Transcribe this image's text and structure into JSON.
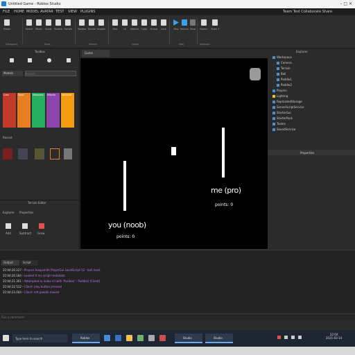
{
  "window": {
    "title": "Untitled Game - Roblox Studio",
    "controls": "–  □  ✕"
  },
  "menubar": {
    "items": [
      "FILE",
      "HOME",
      "MODEL",
      "AVATAR",
      "TEST",
      "VIEW",
      "PLUGINS"
    ],
    "right_text": "Team Test  Collaborate  Share"
  },
  "ribbon": {
    "buttons": [
      "Paste",
      "Select",
      "Move",
      "Scale",
      "Rotate",
      "Transform",
      "Toolbox",
      "Terrain",
      "Import",
      "Part",
      "UI",
      "Material",
      "Color",
      "Group",
      "Lock",
      "Anchor",
      "Play",
      "Resume",
      "Stop",
      "Game Settings",
      "Team Test",
      "Exit Game"
    ],
    "sections": [
      "Clipboard",
      "Tools",
      "Terrain",
      "Insert",
      "Edit",
      "Test",
      "Settings",
      "Team Test"
    ]
  },
  "left_panel": {
    "title": "Toolbox",
    "search_placeholder": "Search",
    "category": "Models",
    "swatches": [
      {
        "label": "Cars",
        "color": "#c0392b"
      },
      {
        "label": "Tools",
        "color": "#e67e22"
      },
      {
        "label": "Weapons",
        "color": "#27ae60"
      },
      {
        "label": "Effects",
        "color": "#8e44ad"
      },
      {
        "label": "Vehicles",
        "color": "#f39c12"
      }
    ],
    "section_two": "Recent",
    "bottom_tabs": [
      "Explorer",
      "Properties"
    ],
    "bottom_title": "Terrain Editor",
    "bottom_items": [
      "Add",
      "Subtract",
      "Grow"
    ]
  },
  "viewport": {
    "tab": "Game",
    "left_player": {
      "name": "you (noob)",
      "points": "points: 0"
    },
    "right_player": {
      "name": "me (pro)",
      "points": "points: 0"
    }
  },
  "right_panel": {
    "title": "Explorer",
    "tree": [
      "Workspace",
      "Camera",
      "Terrain",
      "Ball",
      "Paddle1",
      "Paddle2",
      "Players",
      "Lighting",
      "ReplicatedStorage",
      "ServerScriptService",
      "StarterGui",
      "StarterPack",
      "Teams",
      "SoundService"
    ],
    "properties_title": "Properties"
  },
  "output": {
    "tabs": [
      "Output",
      "Script"
    ],
    "lines": [
      {
        "time": "22:04:20.127",
        "msg": "Players.hoopsmith.PlayerGui.LocalScript:12 - ball reset"
      },
      {
        "time": "22:04:20.184",
        "msg": "Loaded 0 ms script metadata"
      },
      {
        "time": "22:04:21.301",
        "msg": "Attempted to index nil with 'Position' - Paddle1 [Client]"
      },
      {
        "time": "22:04:22.512",
        "msg": "Client: play button pressed"
      },
      {
        "time": "22:04:23.004",
        "msg": "Client: left paddle moved"
      }
    ]
  },
  "cmdbar": {
    "placeholder": "Run a command"
  },
  "taskbar": {
    "search_text": "Type here to search",
    "apps": [
      "Roblox",
      "Studio"
    ],
    "clock_time": "22:04",
    "clock_date": "2021-03-14"
  }
}
